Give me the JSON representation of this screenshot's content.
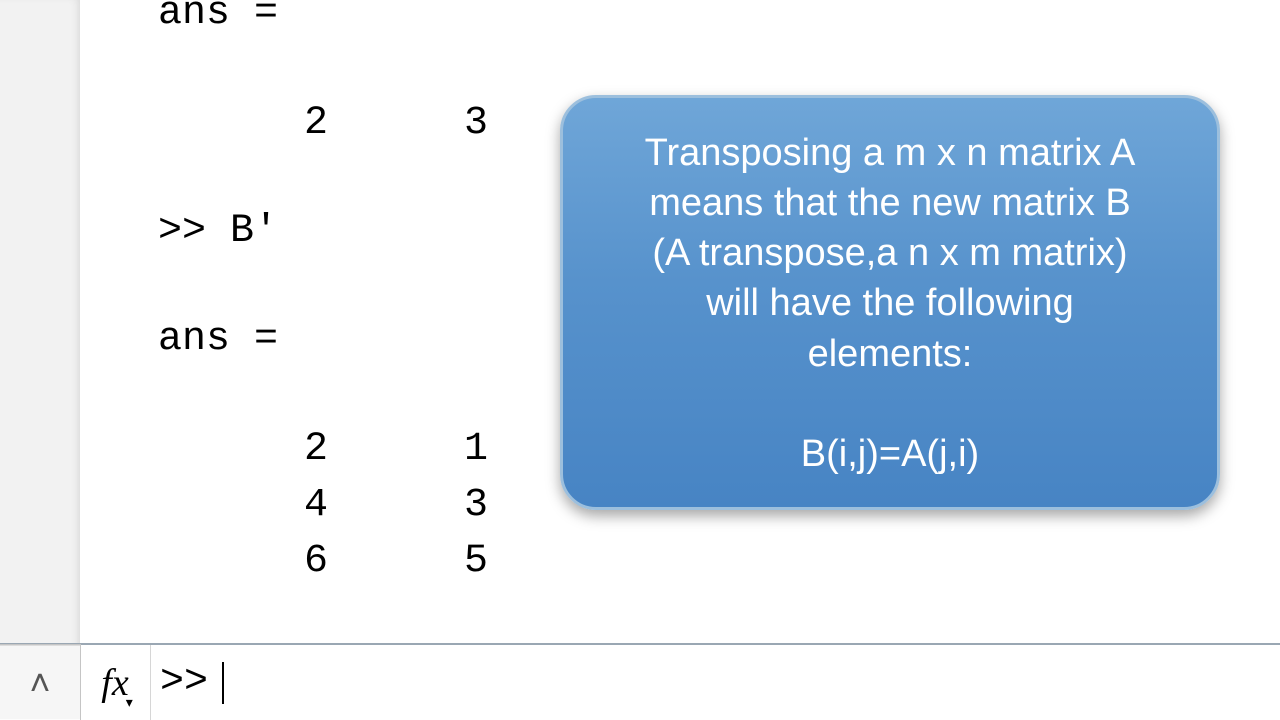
{
  "history": {
    "ans1_label": "ans =",
    "ans1_row": [
      "2",
      "3"
    ],
    "cmd": ">> B'",
    "ans2_label": "ans =",
    "ans2_matrix": [
      [
        "2",
        "1"
      ],
      [
        "4",
        "3"
      ],
      [
        "6",
        "5"
      ]
    ]
  },
  "prompt": {
    "fx_label": "fx",
    "chevron": "˄",
    "prompt_symbol": ">> "
  },
  "callout": {
    "line1": "Transposing a m x n matrix A",
    "line2": "means that the new matrix B",
    "line3": "(A transpose,a n x m matrix)",
    "line4": "will have the following",
    "line5": "elements:",
    "formula": "B(i,j)=A(j,i)"
  }
}
